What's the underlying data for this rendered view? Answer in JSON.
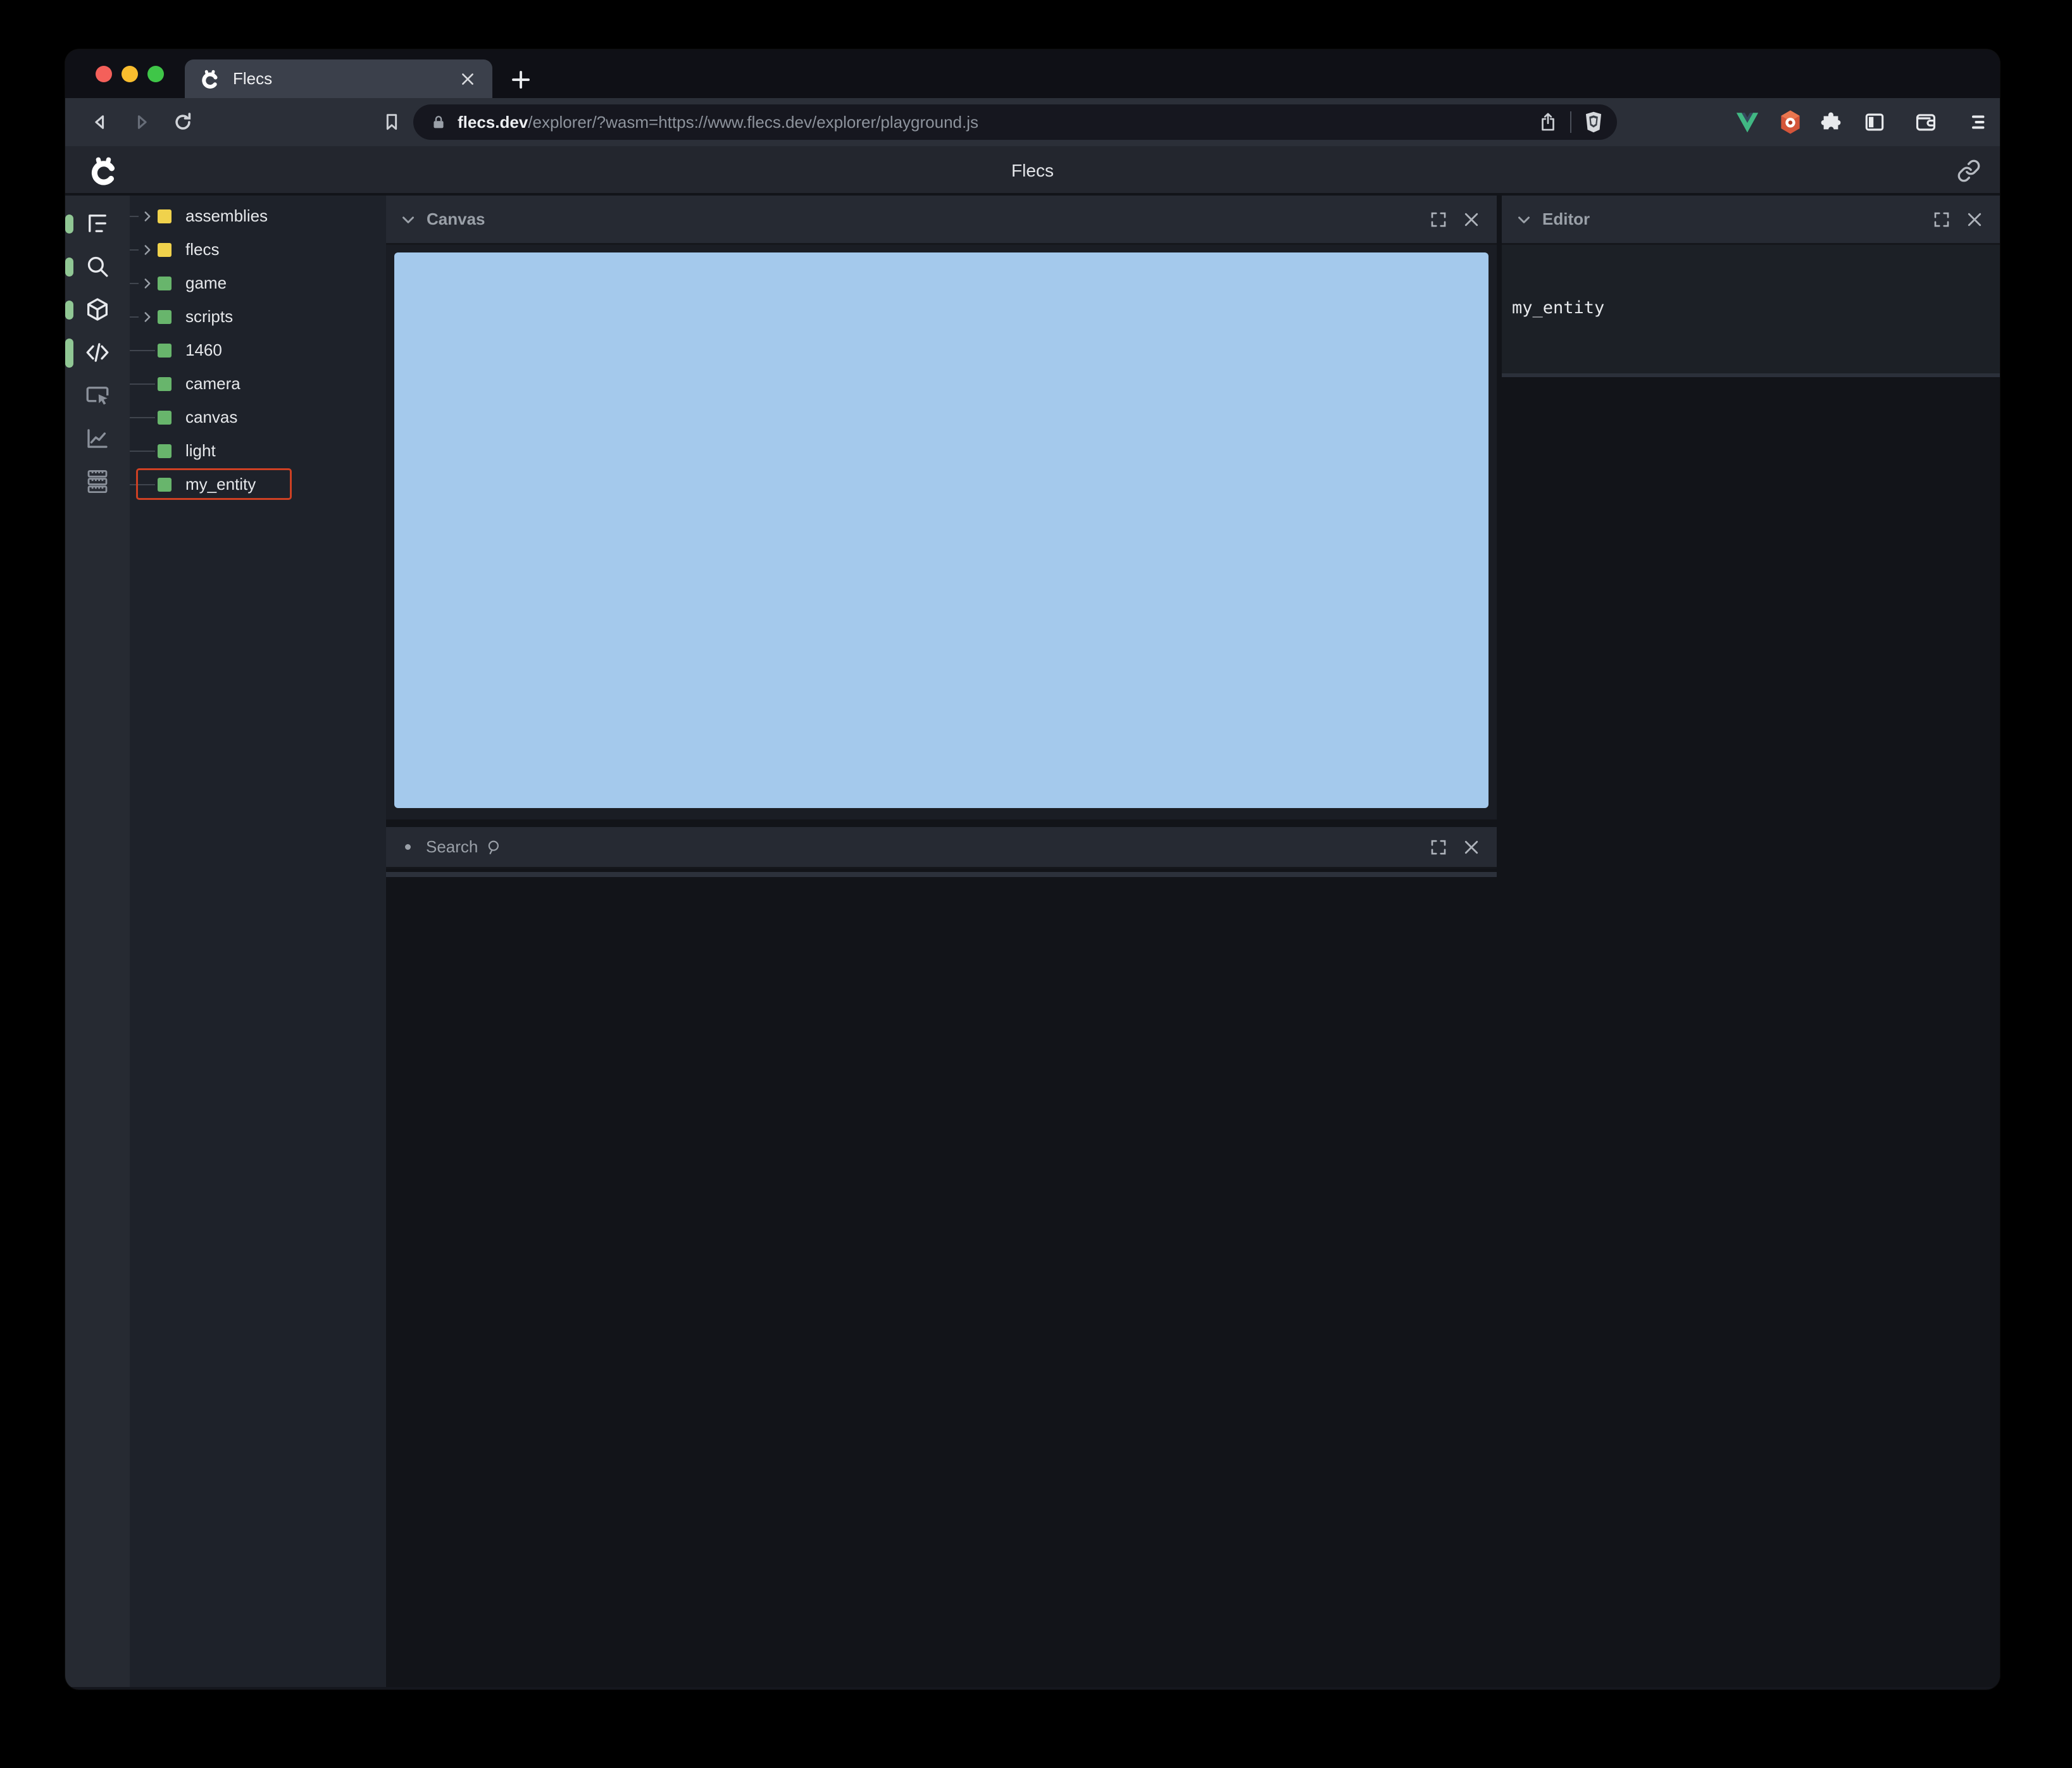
{
  "browser": {
    "tab": {
      "title": "Flecs",
      "close_label": "✕"
    },
    "new_tab_label": "+",
    "url": {
      "domain": "flecs.dev",
      "path": "/explorer/?wasm=https://www.flecs.dev/explorer/playground.js"
    },
    "toolbar_icons": [
      "back",
      "forward",
      "reload",
      "bookmark",
      "share",
      "brave-shield",
      "vue-devtools",
      "extension-hex",
      "extensions-puzzle",
      "sidebar",
      "wallet",
      "menu"
    ]
  },
  "app": {
    "header": {
      "title": "Flecs"
    },
    "rail": {
      "icons": [
        "entity-tree",
        "search",
        "cube",
        "code",
        "inspect",
        "chart",
        "commands"
      ],
      "active_count": 4
    },
    "tree": {
      "items": [
        {
          "label": "assemblies",
          "color": "yellow",
          "expandable": true,
          "highlighted": false
        },
        {
          "label": "flecs",
          "color": "yellow",
          "expandable": true,
          "highlighted": false
        },
        {
          "label": "game",
          "color": "green",
          "expandable": true,
          "highlighted": false
        },
        {
          "label": "scripts",
          "color": "green",
          "expandable": true,
          "highlighted": false
        },
        {
          "label": "1460",
          "color": "green",
          "expandable": false,
          "highlighted": false
        },
        {
          "label": "camera",
          "color": "green",
          "expandable": false,
          "highlighted": false
        },
        {
          "label": "canvas",
          "color": "green",
          "expandable": false,
          "highlighted": false
        },
        {
          "label": "light",
          "color": "green",
          "expandable": false,
          "highlighted": false
        },
        {
          "label": "my_entity",
          "color": "green",
          "expandable": false,
          "highlighted": true
        }
      ]
    },
    "panels": {
      "canvas": {
        "title": "Canvas"
      },
      "search": {
        "title": "Search"
      },
      "editor": {
        "title": "Editor",
        "content": "my_entity"
      }
    }
  },
  "colors": {
    "canvas_blue": "#a4c9ec",
    "tree_yellow": "#f0d24c",
    "tree_green": "#68b56c",
    "highlight_red": "#cd4023",
    "rail_indicator_green": "#90c794",
    "traffic_red": "#f4605a",
    "traffic_yellow": "#f9bd2e",
    "traffic_green": "#3fc648",
    "vue_green": "#41b883",
    "ext_orange": "#d4553a"
  }
}
